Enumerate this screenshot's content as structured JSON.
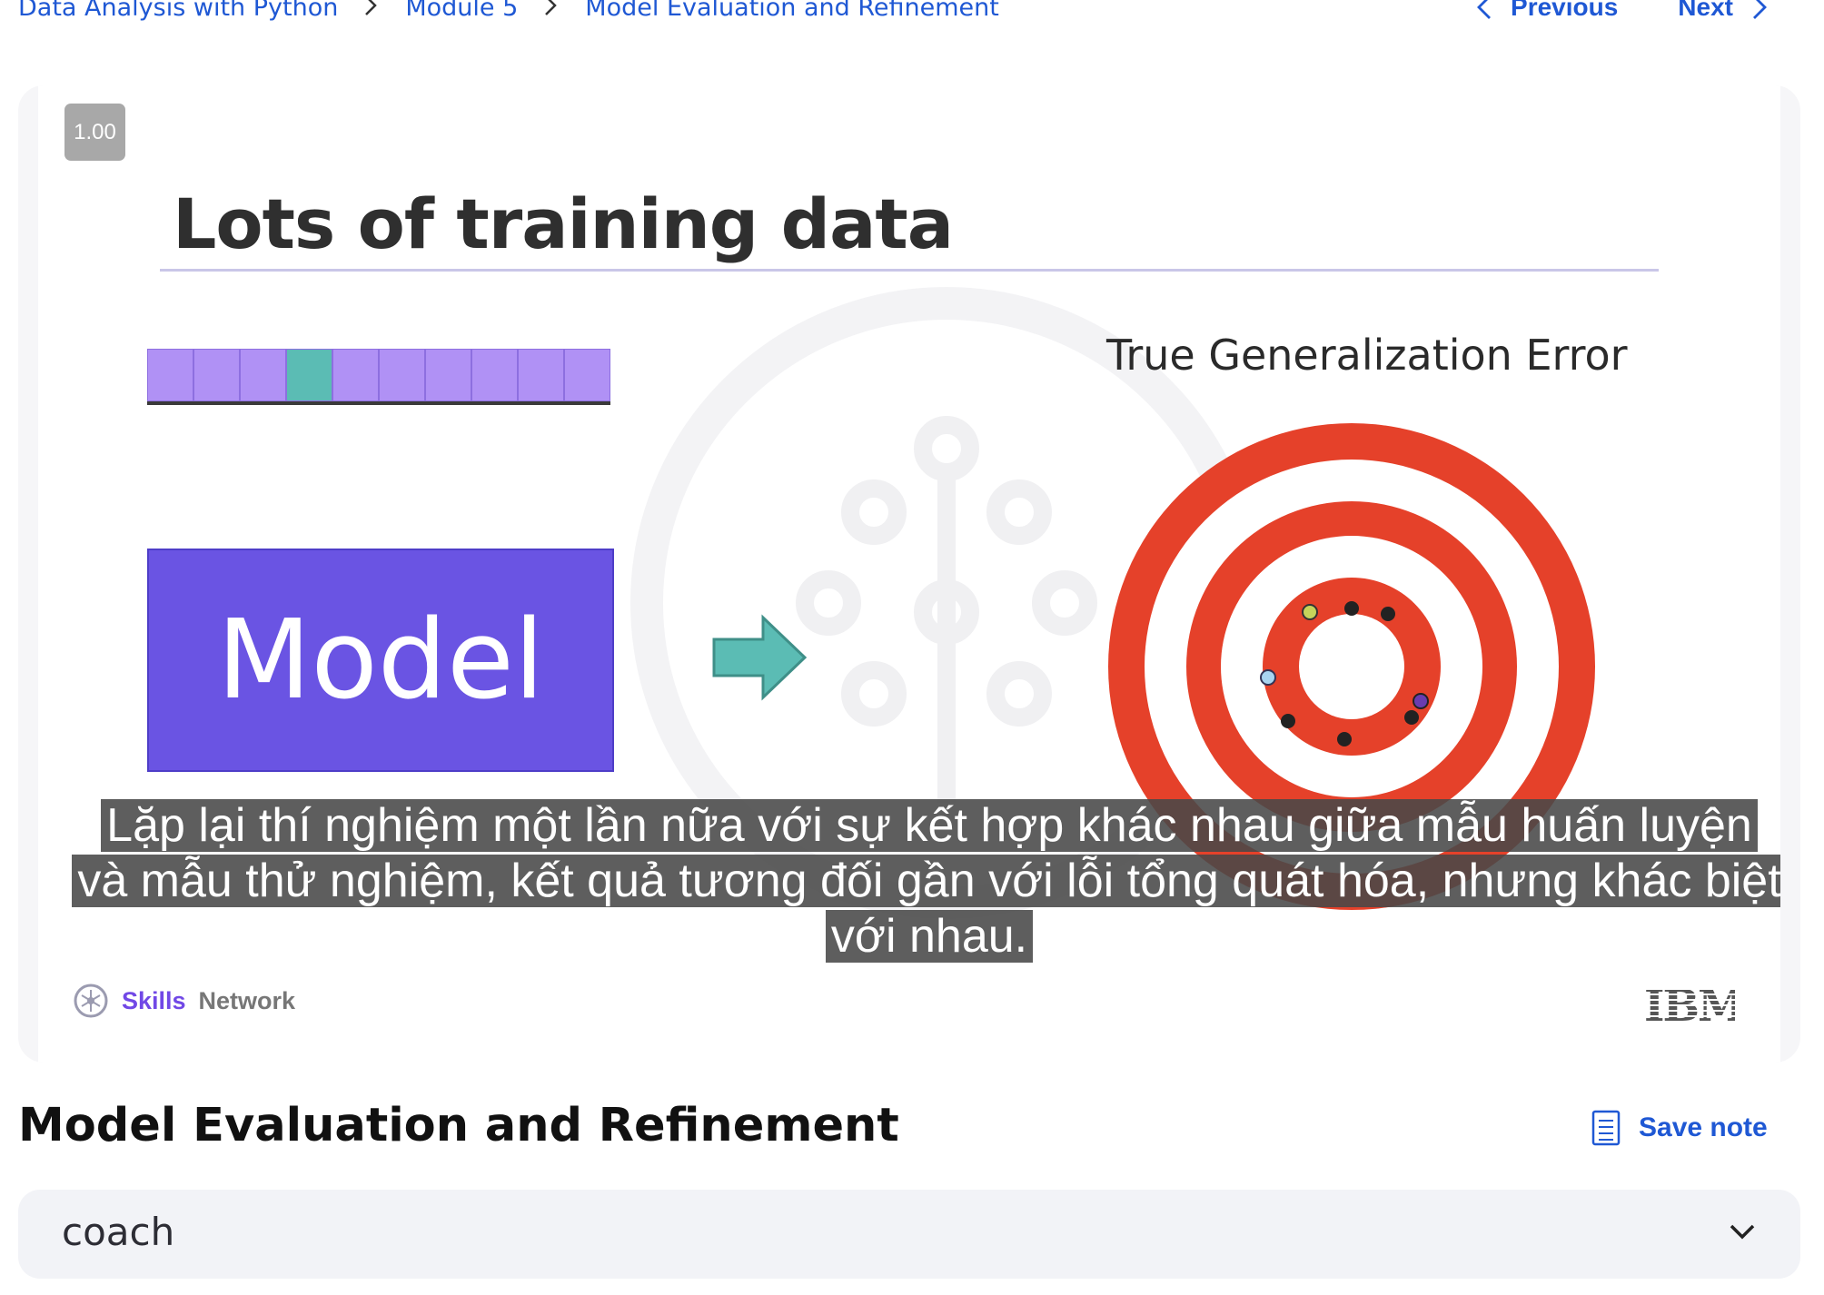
{
  "breadcrumb": {
    "items": [
      "Data Analysis with Python",
      "Module 5",
      "Model Evaluation and Refinement"
    ]
  },
  "nav": {
    "previous": "Previous",
    "next": "Next"
  },
  "video": {
    "speed": "1.00",
    "slide_title": "Lots of training data",
    "model_label": "Model",
    "target_label": "True Generalization Error",
    "subtitle_lines": [
      "Lặp lại thí nghiệm một lần nữa với sự kết hợp khác nhau giữa mẫu huấn luyện",
      "và mẫu thử nghiệm, kết quả tương đối gần với lỗi tổng quát hóa, nhưng khác biệt",
      "với nhau."
    ],
    "brand_skills": "Skills",
    "brand_network": "Network",
    "brand_ibm": "IBM",
    "data_cells": 10,
    "test_cell_index": 3,
    "colors": {
      "train": "#b091f5",
      "test": "#5bbcb4",
      "model": "#6a54e3",
      "target_red": "#e5412a"
    }
  },
  "page_title": "Model Evaluation and Refinement",
  "save_note": "Save note",
  "coach": {
    "label": "coach"
  },
  "icons": [
    "chevron-right-icon",
    "chevron-left-icon",
    "note-icon",
    "chevron-down-icon"
  ]
}
